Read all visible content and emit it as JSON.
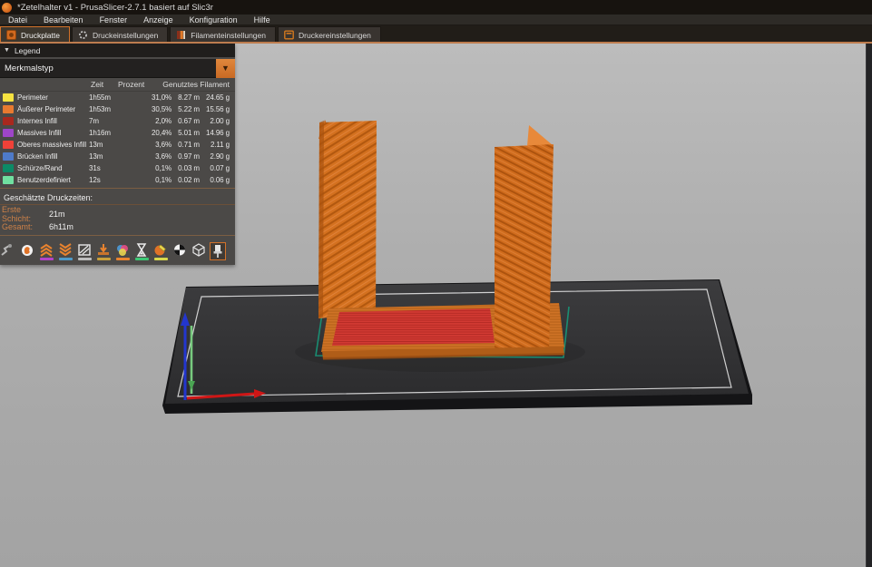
{
  "window": {
    "title": "*Zetelhalter v1 - PrusaSlicer-2.7.1 basiert auf Slic3r"
  },
  "menu": {
    "items": [
      "Datei",
      "Bearbeiten",
      "Fenster",
      "Anzeige",
      "Konfiguration",
      "Hilfe"
    ]
  },
  "tabs": [
    {
      "label": "Druckplatte",
      "active": true
    },
    {
      "label": "Druckeinstellungen",
      "active": false
    },
    {
      "label": "Filamenteinstellungen",
      "active": false
    },
    {
      "label": "Druckereinstellungen",
      "active": false
    }
  ],
  "legend": {
    "title": "Legend",
    "collapse_glyph": "▼",
    "view_mode": "Merkmalstyp",
    "dropdown_glyph": "▼",
    "columns": {
      "time": "Zeit",
      "percent": "Prozent",
      "filament": "Genutztes Filament"
    },
    "accent": "#e8832f",
    "rows": [
      {
        "label": "Perimeter",
        "color": "#f5e240",
        "time": "1h55m",
        "percent": "31,0%",
        "percent_value": 31.0,
        "length": "8.27 m",
        "weight": "24.65 g"
      },
      {
        "label": "Äußerer Perimeter",
        "color": "#e87a30",
        "time": "1h53m",
        "percent": "30,5%",
        "percent_value": 30.5,
        "length": "5.22 m",
        "weight": "15.56 g"
      },
      {
        "label": "Internes Infill",
        "color": "#a8281e",
        "time": "7m",
        "percent": "2,0%",
        "percent_value": 2.0,
        "length": "0.67 m",
        "weight": "2.00 g"
      },
      {
        "label": "Massives Infill",
        "color": "#9e45c8",
        "time": "1h16m",
        "percent": "20,4%",
        "percent_value": 20.4,
        "length": "5.01 m",
        "weight": "14.96 g"
      },
      {
        "label": "Oberes massives Infill",
        "color": "#f04138",
        "time": "13m",
        "percent": "3,6%",
        "percent_value": 3.6,
        "length": "0.71 m",
        "weight": "2.11 g"
      },
      {
        "label": "Brücken Infill",
        "color": "#4e7ac8",
        "time": "13m",
        "percent": "3,6%",
        "percent_value": 3.6,
        "length": "0.97 m",
        "weight": "2.90 g"
      },
      {
        "label": "Schürze/Rand",
        "color": "#0c8a66",
        "time": "31s",
        "percent": "0,1%",
        "percent_value": 0.1,
        "length": "0.03 m",
        "weight": "0.07 g"
      },
      {
        "label": "Benutzerdefiniert",
        "color": "#70e0a0",
        "time": "12s",
        "percent": "0,1%",
        "percent_value": 0.1,
        "length": "0.02 m",
        "weight": "0.06 g"
      }
    ],
    "times": {
      "heading": "Geschätzte Druckzeiten:",
      "first_layer_label": "Erste Schicht:",
      "first_layer_value": "21m",
      "total_label": "Gesamt:",
      "total_value": "6h11m"
    },
    "toolbar_icons": [
      "travel",
      "wipe",
      "deretractions",
      "retractions",
      "seams",
      "tool-changes",
      "color-changes",
      "print-pauses",
      "custom-gcodes",
      "center-of-gravity",
      "shells",
      "legend-pin"
    ]
  }
}
